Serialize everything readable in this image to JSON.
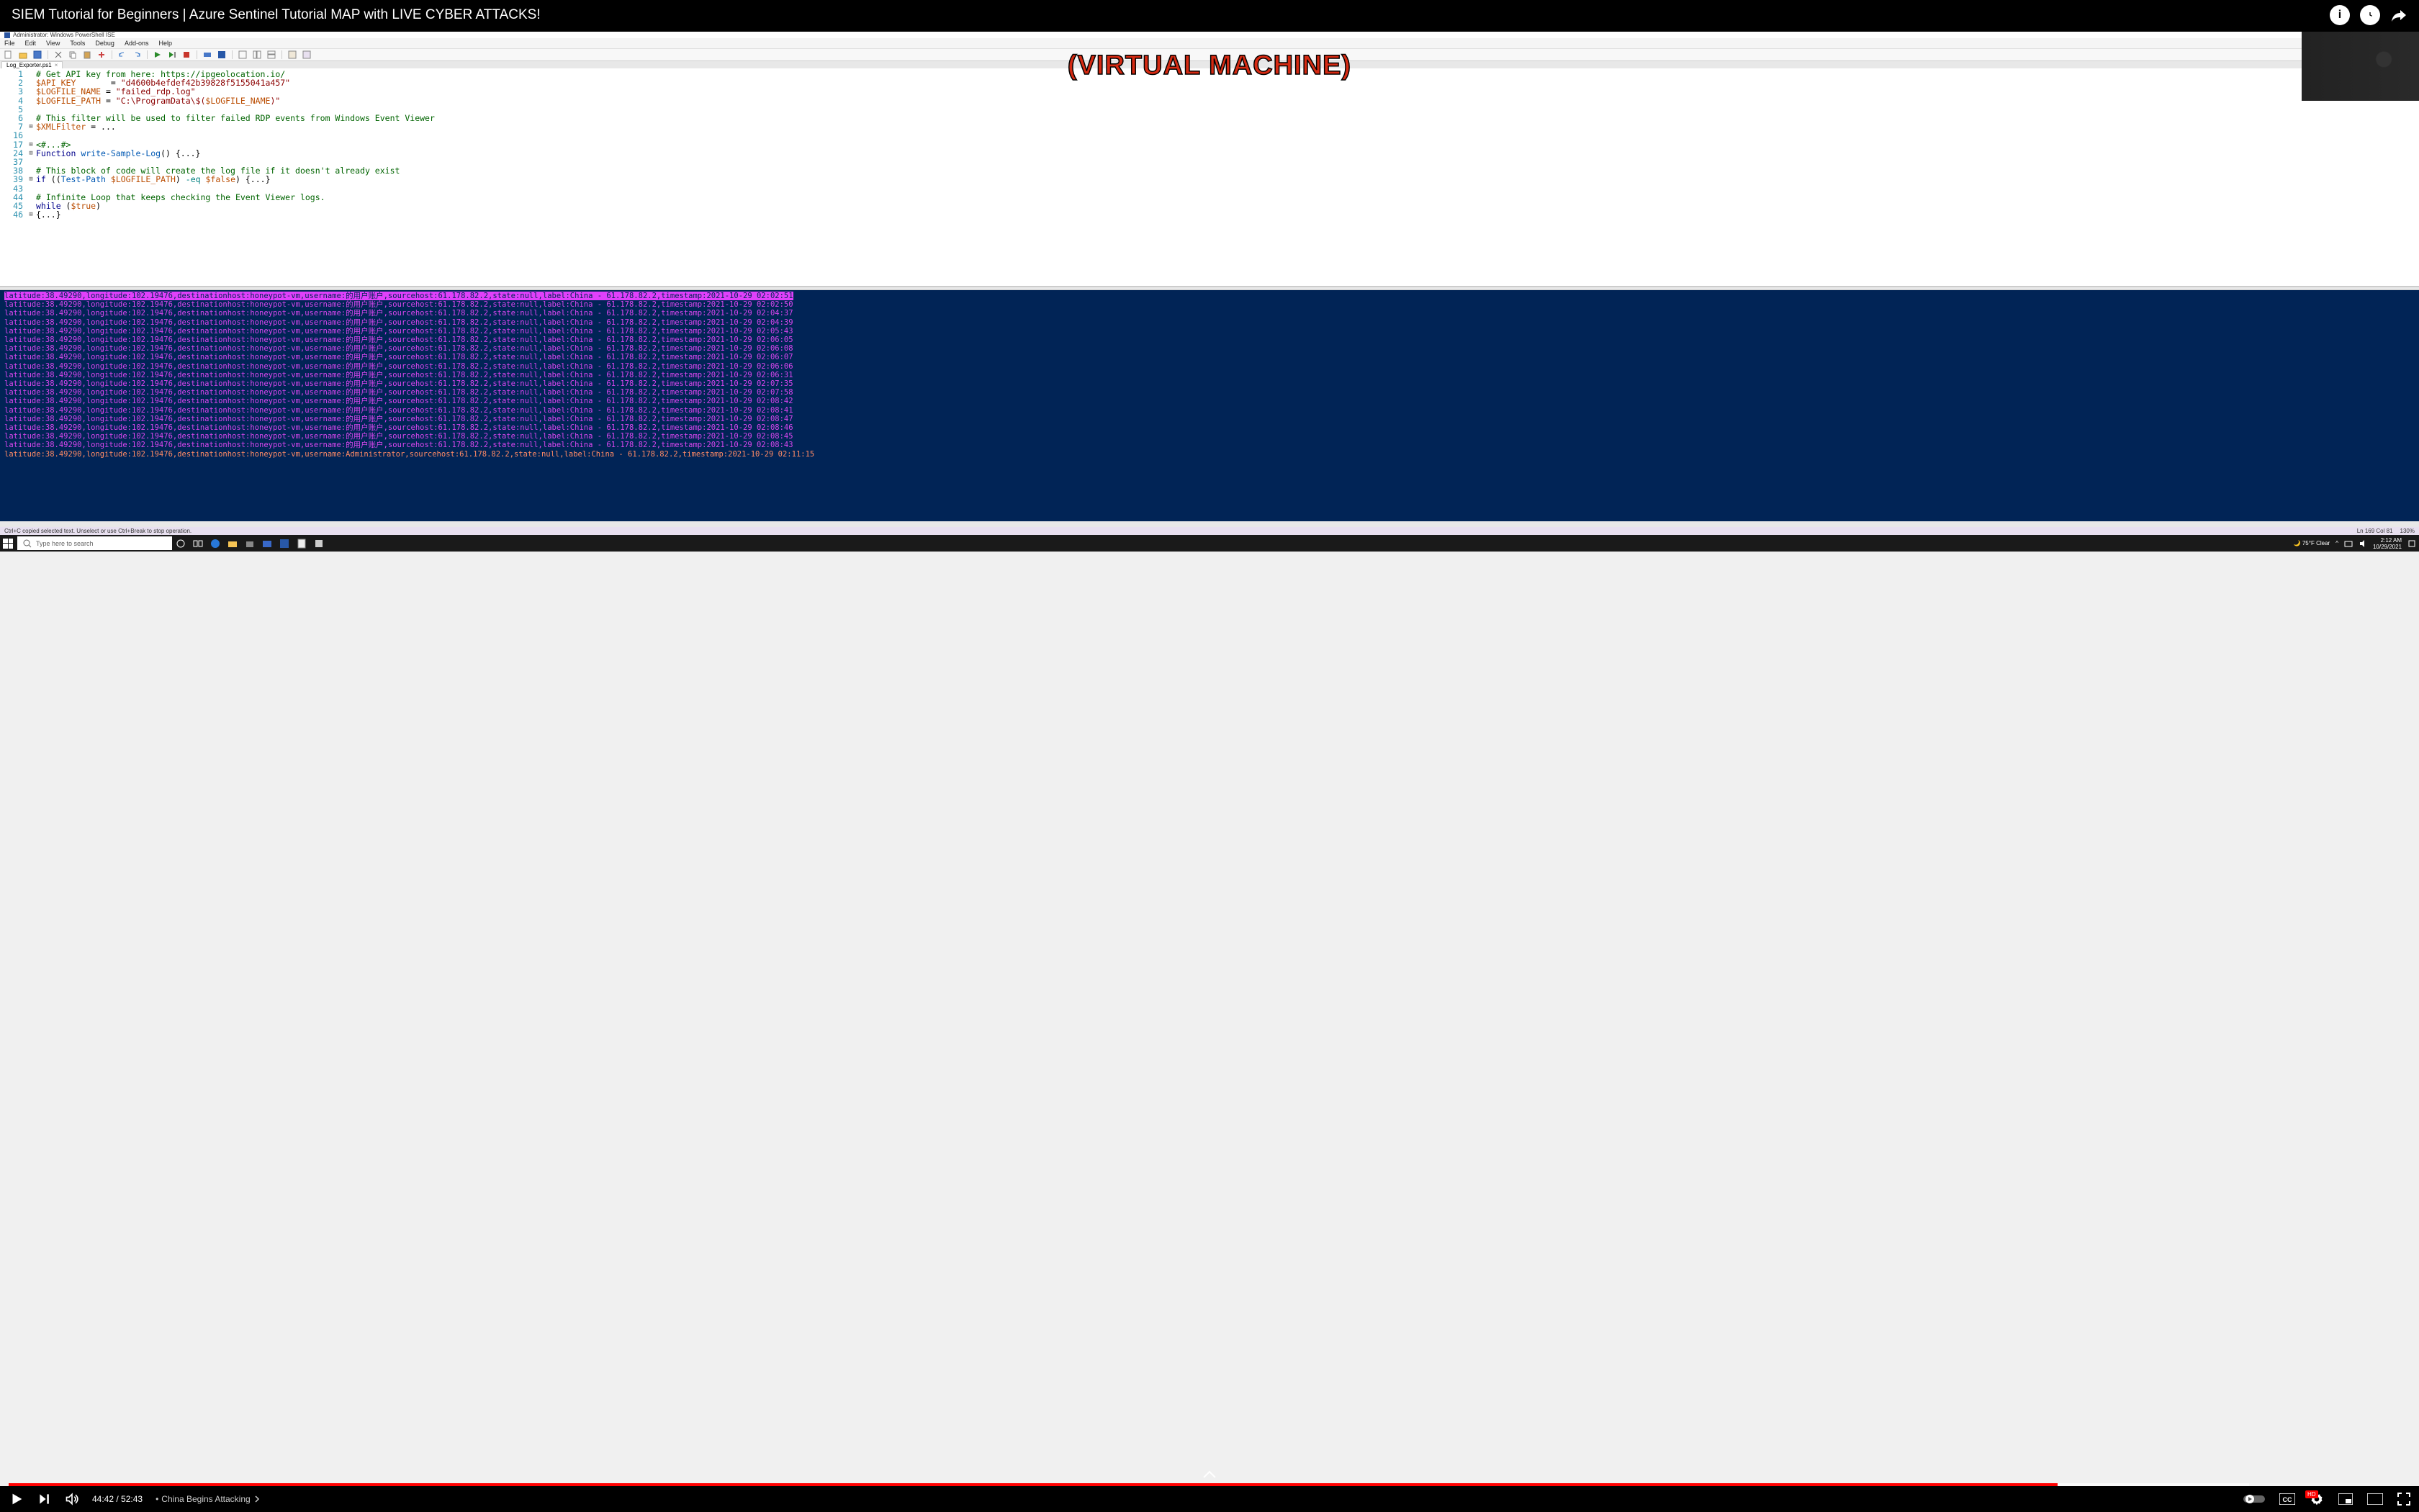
{
  "youtube": {
    "title": "SIEM Tutorial for Beginners | Azure Sentinel Tutorial MAP with LIVE CYBER ATTACKS!",
    "current_time": "44:42",
    "duration": "52:43",
    "chapter": "China Begins Attacking",
    "progress_pct": 85.3
  },
  "overlay_caption": "(VIRTUAL MACHINE)",
  "ise": {
    "window_title": "Administrator: Windows PowerShell ISE",
    "menu": [
      "File",
      "Edit",
      "View",
      "Tools",
      "Debug",
      "Add-ons",
      "Help"
    ],
    "tab_name": "Log_Exporter.ps1",
    "status_left": "Ctrl+C copied selected text. Unselect or use Ctrl+Break to stop operation.",
    "status_ln": "Ln 169  Col 81",
    "status_zoom": "130%",
    "line_numbers": [
      "1",
      "2",
      "3",
      "4",
      "5",
      "6",
      "7",
      "16",
      "17",
      "24",
      "37",
      "38",
      "39",
      "43",
      "44",
      "45",
      "46"
    ],
    "code": {
      "l1_c": "# Get API key from here: https://ipgeolocation.io/",
      "l2_v": "$API_KEY",
      "l2_eq": "       = ",
      "l2_s": "\"d4600b4efdef42b39828f5155041a457\"",
      "l3_v": "$LOGFILE_NAME",
      "l3_eq": " = ",
      "l3_s": "\"failed_rdp.log\"",
      "l4_v": "$LOGFILE_PATH",
      "l4_eq": " = ",
      "l4_s1": "\"C:\\ProgramData\\$(",
      "l4_v2": "$LOGFILE_NAME",
      "l4_s2": ")\"",
      "l6_c": "# This filter will be used to filter failed RDP events from Windows Event Viewer",
      "l7_v": "$XMLFilter",
      "l7_rest": " = ...",
      "l17": "<#...#>",
      "l24_kw": "Function",
      "l24_fn": " write-Sample-Log",
      "l24_rest": "() {...}",
      "l38_c": "# This block of code will create the log file if it doesn't already exist",
      "l39_kw": "if",
      "l39_p1": " ((",
      "l39_cmd": "Test-Path",
      "l39_sp": " ",
      "l39_v": "$LOGFILE_PATH",
      "l39_p2": ") ",
      "l39_op": "-eq",
      "l39_sp2": " ",
      "l39_v2": "$false",
      "l39_rest": ") {...}",
      "l44_c": "# Infinite Loop that keeps checking the Event Viewer logs.",
      "l45_kw": "while",
      "l45_p1": " (",
      "l45_v": "$true",
      "l45_p2": ")",
      "l46": "{...}"
    },
    "console_base": "latitude:38.49290,longitude:102.19476,destinationhost:honeypot-vm,username:的用户账户,sourcehost:61.178.82.2,state:null,label:China - 61.178.82.2,timestamp:2021-10-29 ",
    "console_timestamps": [
      "02:02:51",
      "02:02:50",
      "02:04:37",
      "02:04:39",
      "02:05:43",
      "02:06:05",
      "02:06:08",
      "02:06:07",
      "02:06:06",
      "02:06:31",
      "02:07:35",
      "02:07:58",
      "02:08:42",
      "02:08:41",
      "02:08:47",
      "02:08:46",
      "02:08:45",
      "02:08:43"
    ],
    "console_last": "latitude:38.49290,longitude:102.19476,destinationhost:honeypot-vm,username:Administrator,sourcehost:61.178.82.2,state:null,label:China - 61.178.82.2,timestamp:2021-10-29 02:11:15"
  },
  "taskbar": {
    "search_placeholder": "Type here to search",
    "weather": "75°F  Clear",
    "time": "2:12 AM",
    "date": "10/29/2021"
  }
}
